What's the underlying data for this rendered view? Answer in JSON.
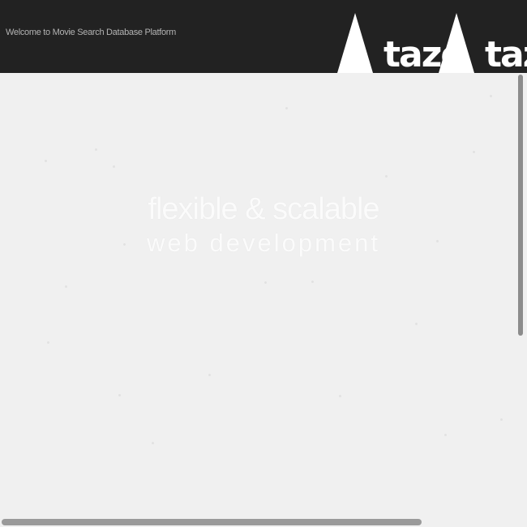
{
  "header": {
    "welcome_text": "Welcome to Movie Search Database Platform",
    "logo_text": "taze",
    "logo_icon": "taze-tree-logo-icon",
    "background_color": "#222222"
  },
  "hero": {
    "line1": "flexible & scalable",
    "line2": "web development",
    "text_color": "#fbfbfb"
  },
  "page": {
    "background_color": "#f0f0f0"
  }
}
